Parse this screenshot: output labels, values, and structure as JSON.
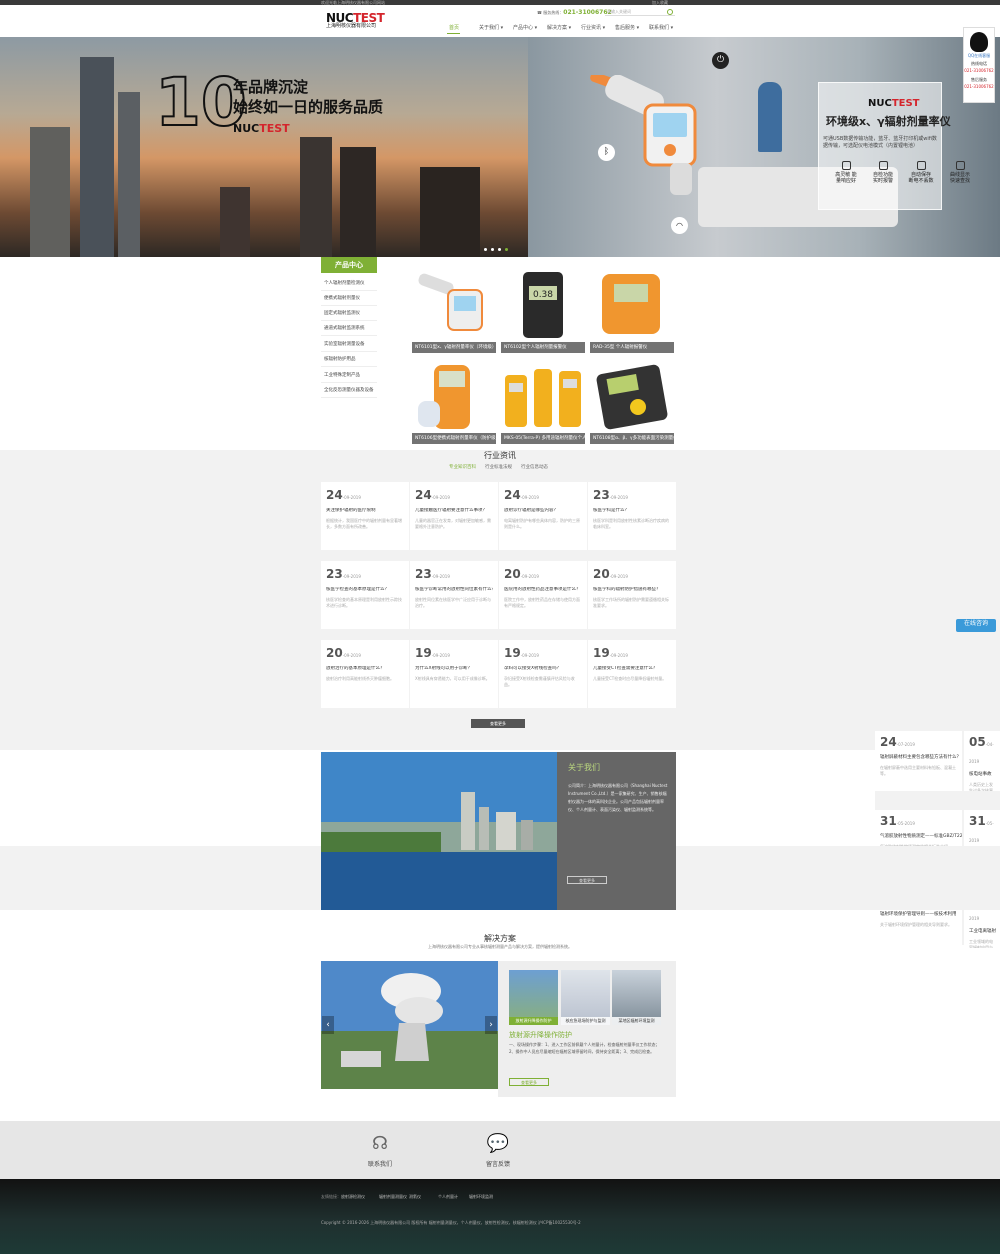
{
  "topbar": {
    "left_text": "欢迎光临上海明核仪器有限公司网站",
    "right_text": "加入收藏"
  },
  "header": {
    "logo": {
      "brand_main": "NUC",
      "brand_accent": "TEST",
      "company": "上海明核仪器有限公司"
    },
    "hotline_label": "服务热线：",
    "hotline_number": "021-31006762",
    "search_placeholder": "请输入关键词",
    "nav": [
      "首页",
      "关于我们",
      "产品中心",
      "解决方案",
      "行业资讯",
      "售后服务",
      "联系我们"
    ]
  },
  "hero": {
    "number": "10",
    "line1": "年品牌沉淀",
    "line2": "始终如一日的服务品质",
    "panel_title": "环境级x、γ辐射剂量率仪",
    "panel_desc": "可通USB数据传输功能，蓝牙、蓝牙打印机或wifi数据传输，可选配仪电池模式（内置锂电池）",
    "features": [
      {
        "icon": "sensitivity-icon",
        "label": "高灵敏 能量响应好"
      },
      {
        "icon": "alarm-icon",
        "label": "自检功能 实时报警"
      },
      {
        "icon": "save-icon",
        "label": "自动保存 断电不丢数"
      },
      {
        "icon": "query-icon",
        "label": "曲线显示 快速查找"
      }
    ]
  },
  "product_center": {
    "title": "产品中心",
    "categories": [
      "个人辐射剂量检测仪",
      "便携式辐射剂量仪",
      "固定式辐射监测仪",
      "通道式辐射监测系统",
      "实验室辐射测量设备",
      "核辐射防护用品",
      "工业特殊定制产品",
      "全化反恐测量仪器及设备"
    ],
    "products": [
      {
        "name": "NT6101型x、γ辐射剂量率仪（环境级）"
      },
      {
        "name": "NT6102型个人辐射剂量报警仪"
      },
      {
        "name": "RAD-35型 个人辐射报警仪"
      },
      {
        "name": "NT6106型便携式辐射剂量率仪（防护级）"
      },
      {
        "name": "MKS-05(Terra-P) 多用途辐射剂量仪个人剂量计"
      },
      {
        "name": "NT6108型α、β、γ多功能表面污染测量仪"
      }
    ]
  },
  "news": {
    "title": "行业资讯",
    "tabs": [
      "专业知识百科",
      "行业标准法规",
      "行业信息动态"
    ],
    "cards": [
      {
        "day": "24",
        "date": "-09-2019",
        "title": "关注保护辐射的医疗限制",
        "excerpt": "根据统计，我国医疗中的辐射剂量有显著增长，多数方面有所改善。"
      },
      {
        "day": "24",
        "date": "-09-2019",
        "title": "儿童接触医疗辐射要注意什么事项？",
        "excerpt": "儿童的器官正在发育，对辐射更加敏感，需要格外注意防护。"
      },
      {
        "day": "24",
        "date": "-09-2019",
        "title": "放射诊疗辐射是哪些内容？",
        "excerpt": "电离辐射防护有哪些具体内容，防护的三原则是什么。"
      },
      {
        "day": "23",
        "date": "-09-2019",
        "title": "核医学科是什么？",
        "excerpt": "核医学科是利用放射性核素诊断治疗疾病的临床科室。"
      },
      {
        "day": "23",
        "date": "-09-2019",
        "title": "核医学检查的基本原理是什么？",
        "excerpt": "核医学检查的基本原理是利用放射性示踪技术进行诊断。"
      },
      {
        "day": "23",
        "date": "-09-2019",
        "title": "核医学诊断常用的放射性同位素有什么？",
        "excerpt": "放射性同位素在核医学中广泛应用于诊断与治疗。"
      },
      {
        "day": "20",
        "date": "-09-2019",
        "title": "医院用的放射性药品注意事项是什么？",
        "excerpt": "医院工作中，放射性药品在存储与使用方面有严格规定。"
      },
      {
        "day": "20",
        "date": "-09-2019",
        "title": "核医学科的辐射防护措施有哪些？",
        "excerpt": "核医学工作场所的辐射防护需要遵循相关标准要求。"
      },
      {
        "day": "20",
        "date": "-09-2019",
        "title": "放射治疗的基本原理是什么？",
        "excerpt": "放射治疗利用高能射线杀灭肿瘤细胞。"
      },
      {
        "day": "19",
        "date": "-09-2019",
        "title": "为什么X射线可以用于诊断？",
        "excerpt": "X射线具有穿透能力，可以用于成像诊断。"
      },
      {
        "day": "19",
        "date": "-09-2019",
        "title": "孕妇可以接受X射线检查吗？",
        "excerpt": "孕妇接受X射线检查需谨慎评估风险与收益。"
      },
      {
        "day": "19",
        "date": "-09-2019",
        "title": "儿童接受CT检查需要注意什么？",
        "excerpt": "儿童接受CT检查时应尽量降低辐射剂量。"
      }
    ],
    "more_label": "查看更多"
  },
  "about": {
    "title": "关于我们",
    "text": "公司简介：上海明核仪器有限公司（Shanghai Nuctest Instrument Co.,Ltd.）是一家集研究、生产、销售核辐射仪器为一体的高科技企业。公司产品包括辐射剂量率仪、个人剂量计、表面污染仪、辐射监测系统等。",
    "button": "查看更多"
  },
  "solutions": {
    "title": "解决方案",
    "subtitle": "上海明核仪器有限公司专业从事核辐射测量产品与解决方案，提供辐射检测系统。",
    "thumbs": [
      "放射源升降操作防护",
      "核应急现场防护与监测",
      "某地区辐射环境监测"
    ],
    "name": "放射源升降操作防护",
    "desc": "一、现场操作步骤：1、进入工作区前佩戴个人剂量计，检查辐射剂量率仪工作状态；2、操作中人员应尽量缩短在辐射区域停留时间，保持安全距离；3、完成后检查。",
    "button": "查看更多"
  },
  "contact": {
    "call_label": "联系我们",
    "feedback_label": "留言反馈"
  },
  "footer": {
    "links_label": "友情链接：",
    "links": [
      "放射源检测仪",
      "辐射剂量测量仪",
      "测氡仪",
      "个人剂量计",
      "辐射环境监测"
    ],
    "copyright": "Copyright © 2016-2026 上海明核仪器有限公司 版权所有 辐射剂量测量仪，个人剂量仪，放射性检测仪，核辐射检测仪 沪ICP备10025530号-2"
  },
  "widgets": {
    "qq_label": "QQ在线客服",
    "hot1_label": "热线电话",
    "hot1_number": "021-31006762",
    "hot2_label": "售后服务",
    "hot2_number": "021-31006762",
    "online_label": "在线咨询",
    "side_news": [
      {
        "day": "24",
        "date": "-07-2019",
        "title": "辐射屏蔽材料主要包含哪些方法有什么？",
        "excerpt": "在辐射屏蔽中选用主要材料有铅板、混凝土等。"
      },
      {
        "day": "05",
        "date": "-04-2019",
        "title": "核电站事故",
        "excerpt": "人类历史上发生过多次核事故。"
      },
      {
        "day": "31",
        "date": "-05-2019",
        "title": "气溶胶放射性物质测定——标准GBZ/T22",
        "excerpt": "气溶胶放射性物质测定的相关标准介绍。"
      },
      {
        "day": "31",
        "date": "-05-2019",
        "title": "环境辐射监测",
        "excerpt": "环境辐射监测是监测环境电离辐射的重要手段。"
      },
      {
        "day": "27",
        "date": "-05-2019",
        "title": "辐射环境保护管理导则——核技术利用",
        "excerpt": "关于辐射环境保护管理的相关导则要求。"
      },
      {
        "day": "23",
        "date": "-05-2019",
        "title": "工业电离辐射",
        "excerpt": "工业领域的电离辐射应用与防护。"
      }
    ]
  }
}
